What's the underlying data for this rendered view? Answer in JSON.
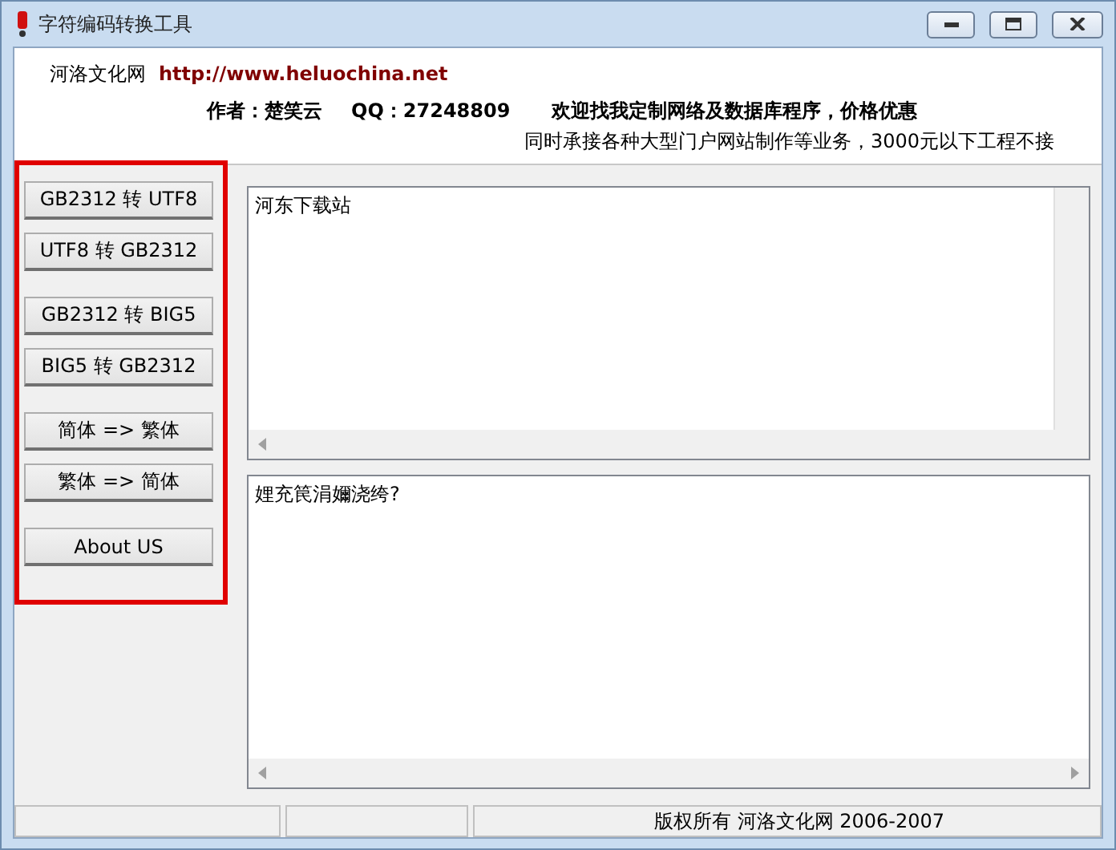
{
  "window": {
    "title": "字符编码转换工具"
  },
  "header": {
    "site_name": "河洛文化网",
    "site_url": "http://www.heluochina.net",
    "author": "作者：楚笑云",
    "qq": "QQ：27248809",
    "slogan": "欢迎找我定制网络及数据库程序，价格优惠",
    "note": "同时承接各种大型门户网站制作等业务，3000元以下工程不接"
  },
  "button_groups": [
    [
      "GB2312 转 UTF8",
      "UTF8 转 GB2312"
    ],
    [
      "GB2312 转 BIG5",
      "BIG5 转 GB2312"
    ],
    [
      "简体 => 繁体",
      "繁体 => 简体"
    ],
    [
      "About US"
    ]
  ],
  "input_text": "河东下载站",
  "output_text": "娌充笢涓嬭浇绔?",
  "status_bar": {
    "panel_3": "版权所有  河洛文化网  2006-2007"
  }
}
